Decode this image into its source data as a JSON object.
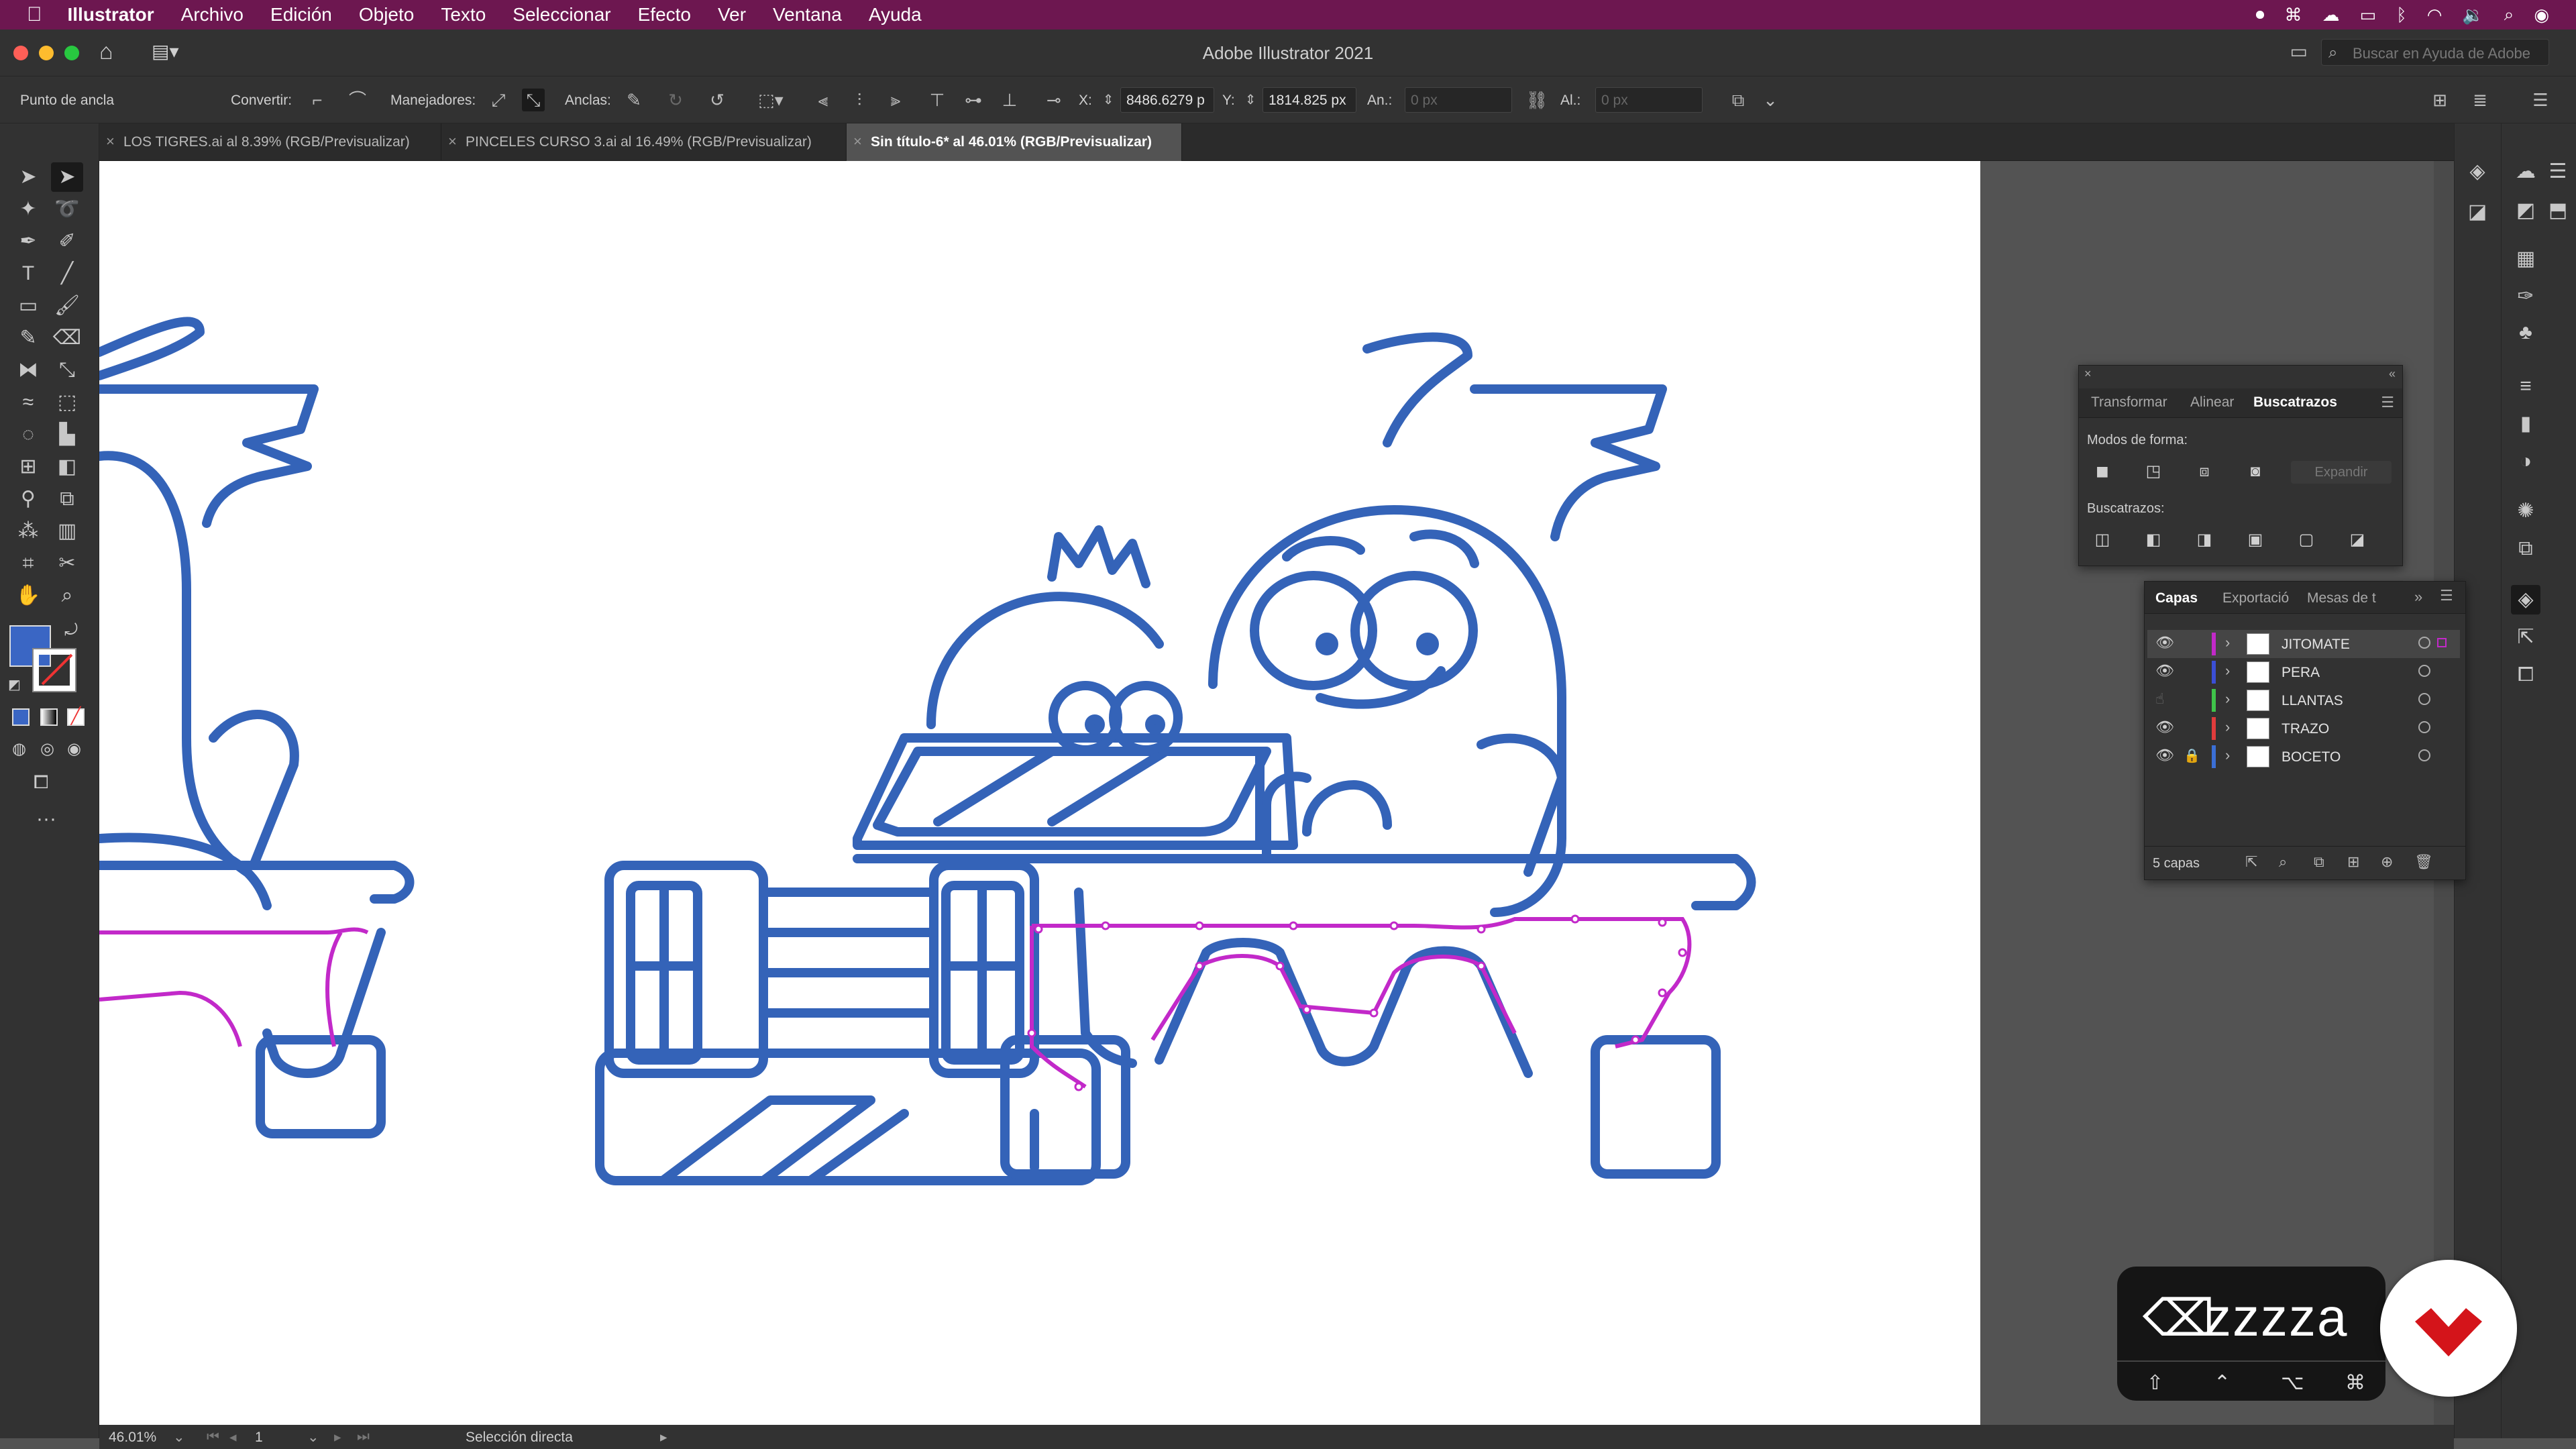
{
  "menubar": {
    "app": "Illustrator",
    "items": [
      "Archivo",
      "Edición",
      "Objeto",
      "Texto",
      "Seleccionar",
      "Efecto",
      "Ver",
      "Ventana",
      "Ayuda"
    ]
  },
  "window": {
    "title": "Adobe Illustrator 2021",
    "search_placeholder": "Buscar en Ayuda de Adobe"
  },
  "controlbar": {
    "mode_label": "Punto de ancla",
    "convert_label": "Convertir:",
    "handles_label": "Manejadores:",
    "anchors_label": "Anclas:",
    "x_label": "X:",
    "x_value": "8486.6279 p",
    "y_label": "Y:",
    "y_value": "1814.825 px",
    "w_label": "An.:",
    "w_value": "0 px",
    "h_label": "Al.:",
    "h_value": "0 px"
  },
  "tabs": [
    {
      "label": "LOS TIGRES.ai al 8.39% (RGB/Previsualizar)",
      "active": false
    },
    {
      "label": "PINCELES CURSO 3.ai al 16.49% (RGB/Previsualizar)",
      "active": false
    },
    {
      "label": "Sin título-6* al 46.01% (RGB/Previsualizar)",
      "active": true
    }
  ],
  "pathfinder_panel": {
    "tabs": [
      "Transformar",
      "Alinear",
      "Buscatrazos"
    ],
    "active_tab": "Buscatrazos",
    "shape_modes_label": "Modos de forma:",
    "expand_label": "Expandir",
    "pathfinders_label": "Buscatrazos:"
  },
  "layers_panel": {
    "tabs": [
      "Capas",
      "Exportació",
      "Mesas de t"
    ],
    "active_tab": "Capas",
    "layers": [
      {
        "name": "JITOMATE",
        "color": "#c229c9",
        "visible": true,
        "locked": false,
        "selected": true
      },
      {
        "name": "PERA",
        "color": "#3b4fd6",
        "visible": true,
        "locked": false,
        "selected": false
      },
      {
        "name": "LLANTAS",
        "color": "#3fc44a",
        "visible": false,
        "locked": false,
        "selected": false
      },
      {
        "name": "TRAZO",
        "color": "#e03c3c",
        "visible": true,
        "locked": false,
        "selected": false
      },
      {
        "name": "BOCETO",
        "color": "#3b6fd6",
        "visible": true,
        "locked": true,
        "selected": false
      }
    ],
    "footer_count": "5 capas"
  },
  "statusbar": {
    "zoom": "46.01%",
    "artboard_number": "1",
    "tool_name": "Selección directa"
  },
  "key_overlay": {
    "typed": "zzzza",
    "modifiers": [
      "shift-icon",
      "control-icon",
      "option-icon",
      "command-icon"
    ]
  },
  "colors": {
    "stroke_blue": "#3463b8",
    "selection_magenta": "#c229c9",
    "fill_swatch": "#3a66c4",
    "menubar": "#6d1750"
  }
}
